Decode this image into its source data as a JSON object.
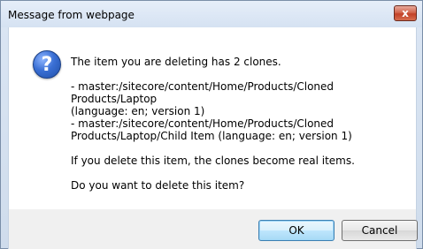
{
  "window": {
    "title": "Message from webpage",
    "close_glyph": "x"
  },
  "icon": {
    "name": "question-icon",
    "glyph": "?"
  },
  "message": {
    "line1": "The item you are deleting has 2 clones.",
    "clone1_line1": "- master:/sitecore/content/Home/Products/Cloned Products/Laptop",
    "clone1_line2": "(language: en; version 1)",
    "clone2_line1": "- master:/sitecore/content/Home/Products/Cloned",
    "clone2_line2": "Products/Laptop/Child Item (language: en; version 1)",
    "warning": "If you delete this item, the clones become real items.",
    "question": "Do you want to delete this item?"
  },
  "buttons": {
    "ok_label": "OK",
    "cancel_label": "Cancel"
  }
}
